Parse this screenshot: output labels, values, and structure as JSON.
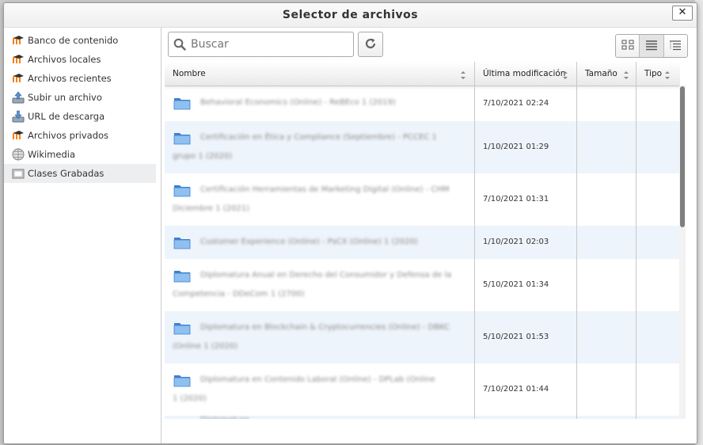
{
  "dialog": {
    "title": "Selector de archivos",
    "close_label": "✕"
  },
  "sidebar": {
    "items": [
      {
        "label": "Banco de contenido",
        "icon": "moodle-icon"
      },
      {
        "label": "Archivos locales",
        "icon": "moodle-icon"
      },
      {
        "label": "Archivos recientes",
        "icon": "moodle-icon"
      },
      {
        "label": "Subir un archivo",
        "icon": "upload-icon"
      },
      {
        "label": "URL de descarga",
        "icon": "download-url-icon"
      },
      {
        "label": "Archivos privados",
        "icon": "moodle-icon"
      },
      {
        "label": "Wikimedia",
        "icon": "wikimedia-icon"
      },
      {
        "label": "Clases Grabadas",
        "icon": "folder-repo-icon",
        "active": true
      }
    ]
  },
  "toolbar": {
    "search_placeholder": "Buscar"
  },
  "table": {
    "headers": {
      "name": "Nombre",
      "modified": "Última modificación",
      "size": "Tamaño",
      "type": "Tipo"
    },
    "rows": [
      {
        "name_line1": "Behavioral Economics (Online) - ReBEco 1 (2019)",
        "name_line2": "",
        "modified": "7/10/2021 02:24"
      },
      {
        "name_line1": "Certificación en Ética y Compliance (Septiembre) - PCCEC 1",
        "name_line2": "grupo 1 (2020)",
        "modified": "1/10/2021 01:29"
      },
      {
        "name_line1": "Certificación Herramientas de Marketing Digital (Online) - CHM",
        "name_line2": "Diciembre 1 (2021)",
        "modified": "7/10/2021 01:31"
      },
      {
        "name_line1": "Customer Experience (Online) - PsCX (Online) 1 (2020)",
        "name_line2": "",
        "modified": "1/10/2021 02:03"
      },
      {
        "name_line1": "Diplomatura Anual en Derecho del Consumidor y Defensa de la",
        "name_line2": "Competencia - DDeCom 1 (2700)",
        "modified": "5/10/2021 01:34"
      },
      {
        "name_line1": "Diplomatura en Blockchain & Cryptocurrencies (Online) - DBKC",
        "name_line2": "(Online 1 (2020)",
        "modified": "5/10/2021 01:53"
      },
      {
        "name_line1": "Diplomatura en Contenido Laboral (Online) - DPLab (Online",
        "name_line2": "1 (2020)",
        "modified": "7/10/2021 01:44"
      },
      {
        "name_line1": "Diplomatura",
        "name_line2": "",
        "modified": ""
      }
    ]
  }
}
